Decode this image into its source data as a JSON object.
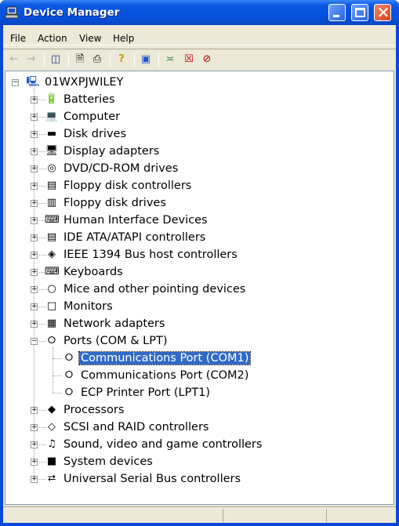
{
  "window": {
    "title": "Device Manager",
    "controls": [
      "minimize",
      "maximize",
      "close"
    ]
  },
  "menubar": [
    "File",
    "Action",
    "View",
    "Help"
  ],
  "toolbar": [
    {
      "name": "back-icon",
      "glyph": "←",
      "enabled": false
    },
    {
      "name": "forward-icon",
      "glyph": "→",
      "enabled": false
    },
    {
      "name": "show-hide-console-tree-icon",
      "glyph": "◫",
      "enabled": true
    },
    {
      "name": "properties-icon",
      "glyph": "☷",
      "enabled": true
    },
    {
      "name": "print-icon",
      "glyph": "⎙",
      "enabled": true
    },
    {
      "name": "help-icon",
      "glyph": "?",
      "enabled": true
    },
    {
      "name": "update-driver-icon",
      "glyph": "▣",
      "enabled": true
    },
    {
      "name": "scan-hardware-icon",
      "glyph": "✂",
      "enabled": true
    },
    {
      "name": "uninstall-icon",
      "glyph": "☒",
      "enabled": true
    },
    {
      "name": "disable-icon",
      "glyph": "⊘",
      "enabled": true
    }
  ],
  "tree": {
    "root": "01WXPJWILEY",
    "categories": [
      {
        "label": "Batteries",
        "icon": "battery-icon",
        "glyph": "🔋"
      },
      {
        "label": "Computer",
        "icon": "computer-icon",
        "glyph": "💻"
      },
      {
        "label": "Disk drives",
        "icon": "disk-drive-icon",
        "glyph": "▬"
      },
      {
        "label": "Display adapters",
        "icon": "display-adapter-icon",
        "glyph": "🖥"
      },
      {
        "label": "DVD/CD-ROM drives",
        "icon": "cdrom-icon",
        "glyph": "◎"
      },
      {
        "label": "Floppy disk controllers",
        "icon": "floppy-controller-icon",
        "glyph": "▤"
      },
      {
        "label": "Floppy disk drives",
        "icon": "floppy-drive-icon",
        "glyph": "▥"
      },
      {
        "label": "Human Interface Devices",
        "icon": "hid-icon",
        "glyph": "⌨"
      },
      {
        "label": "IDE ATA/ATAPI controllers",
        "icon": "ide-controller-icon",
        "glyph": "▤"
      },
      {
        "label": "IEEE 1394 Bus host controllers",
        "icon": "ieee1394-icon",
        "glyph": "◈"
      },
      {
        "label": "Keyboards",
        "icon": "keyboard-icon",
        "glyph": "⌨"
      },
      {
        "label": "Mice and other pointing devices",
        "icon": "mouse-icon",
        "glyph": "○"
      },
      {
        "label": "Monitors",
        "icon": "monitor-icon",
        "glyph": "□"
      },
      {
        "label": "Network adapters",
        "icon": "network-adapter-icon",
        "glyph": "▦"
      },
      {
        "label": "Ports (COM & LPT)",
        "icon": "port-icon",
        "glyph": "⭘",
        "expanded": true,
        "children": [
          {
            "label": "Communications Port (COM1)",
            "selected": true
          },
          {
            "label": "Communications Port (COM2)"
          },
          {
            "label": "ECP Printer Port (LPT1)"
          }
        ]
      },
      {
        "label": "Processors",
        "icon": "processor-icon",
        "glyph": "◆"
      },
      {
        "label": "SCSI and RAID controllers",
        "icon": "scsi-icon",
        "glyph": "◇"
      },
      {
        "label": "Sound, video and game controllers",
        "icon": "sound-icon",
        "glyph": "♫"
      },
      {
        "label": "System devices",
        "icon": "system-device-icon",
        "glyph": "■"
      },
      {
        "label": "Universal Serial Bus controllers",
        "icon": "usb-icon",
        "glyph": "⮂"
      }
    ]
  }
}
